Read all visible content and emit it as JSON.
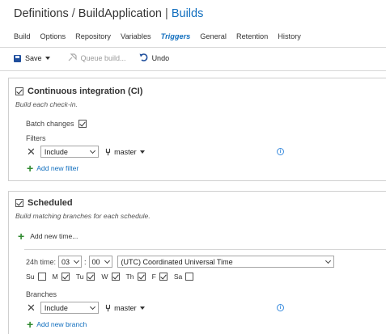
{
  "header": {
    "crumb1": "Definitions",
    "separator": "/",
    "crumb2": "BuildApplication",
    "pipe": "|",
    "crumb3": "Builds"
  },
  "tabs": [
    {
      "label": "Build",
      "active": false
    },
    {
      "label": "Options",
      "active": false
    },
    {
      "label": "Repository",
      "active": false
    },
    {
      "label": "Variables",
      "active": false
    },
    {
      "label": "Triggers",
      "active": true
    },
    {
      "label": "General",
      "active": false
    },
    {
      "label": "Retention",
      "active": false
    },
    {
      "label": "History",
      "active": false
    }
  ],
  "toolbar": {
    "save_label": "Save",
    "queue_label": "Queue build...",
    "undo_label": "Undo"
  },
  "ci": {
    "enabled": true,
    "title": "Continuous integration (CI)",
    "subtitle": "Build each check-in.",
    "batch_label": "Batch changes",
    "batch_checked": true,
    "filters_label": "Filters",
    "filter_type": "Include",
    "filter_branch": "master",
    "add_filter_label": "Add new filter"
  },
  "scheduled": {
    "enabled": true,
    "title": "Scheduled",
    "subtitle": "Build matching branches for each schedule.",
    "add_time_label": "Add new time...",
    "time_label": "24h time:",
    "hour": "03",
    "colon": ":",
    "minute": "00",
    "timezone": "(UTC) Coordinated Universal Time",
    "days": [
      {
        "label": "Su",
        "checked": false
      },
      {
        "label": "M",
        "checked": true
      },
      {
        "label": "Tu",
        "checked": true
      },
      {
        "label": "W",
        "checked": true
      },
      {
        "label": "Th",
        "checked": true
      },
      {
        "label": "F",
        "checked": true
      },
      {
        "label": "Sa",
        "checked": false
      }
    ],
    "branches_label": "Branches",
    "filter_type": "Include",
    "filter_branch": "master",
    "add_branch_label": "Add new branch"
  },
  "colors": {
    "accent": "#106ebe",
    "add_green": "#2f8a2f"
  }
}
